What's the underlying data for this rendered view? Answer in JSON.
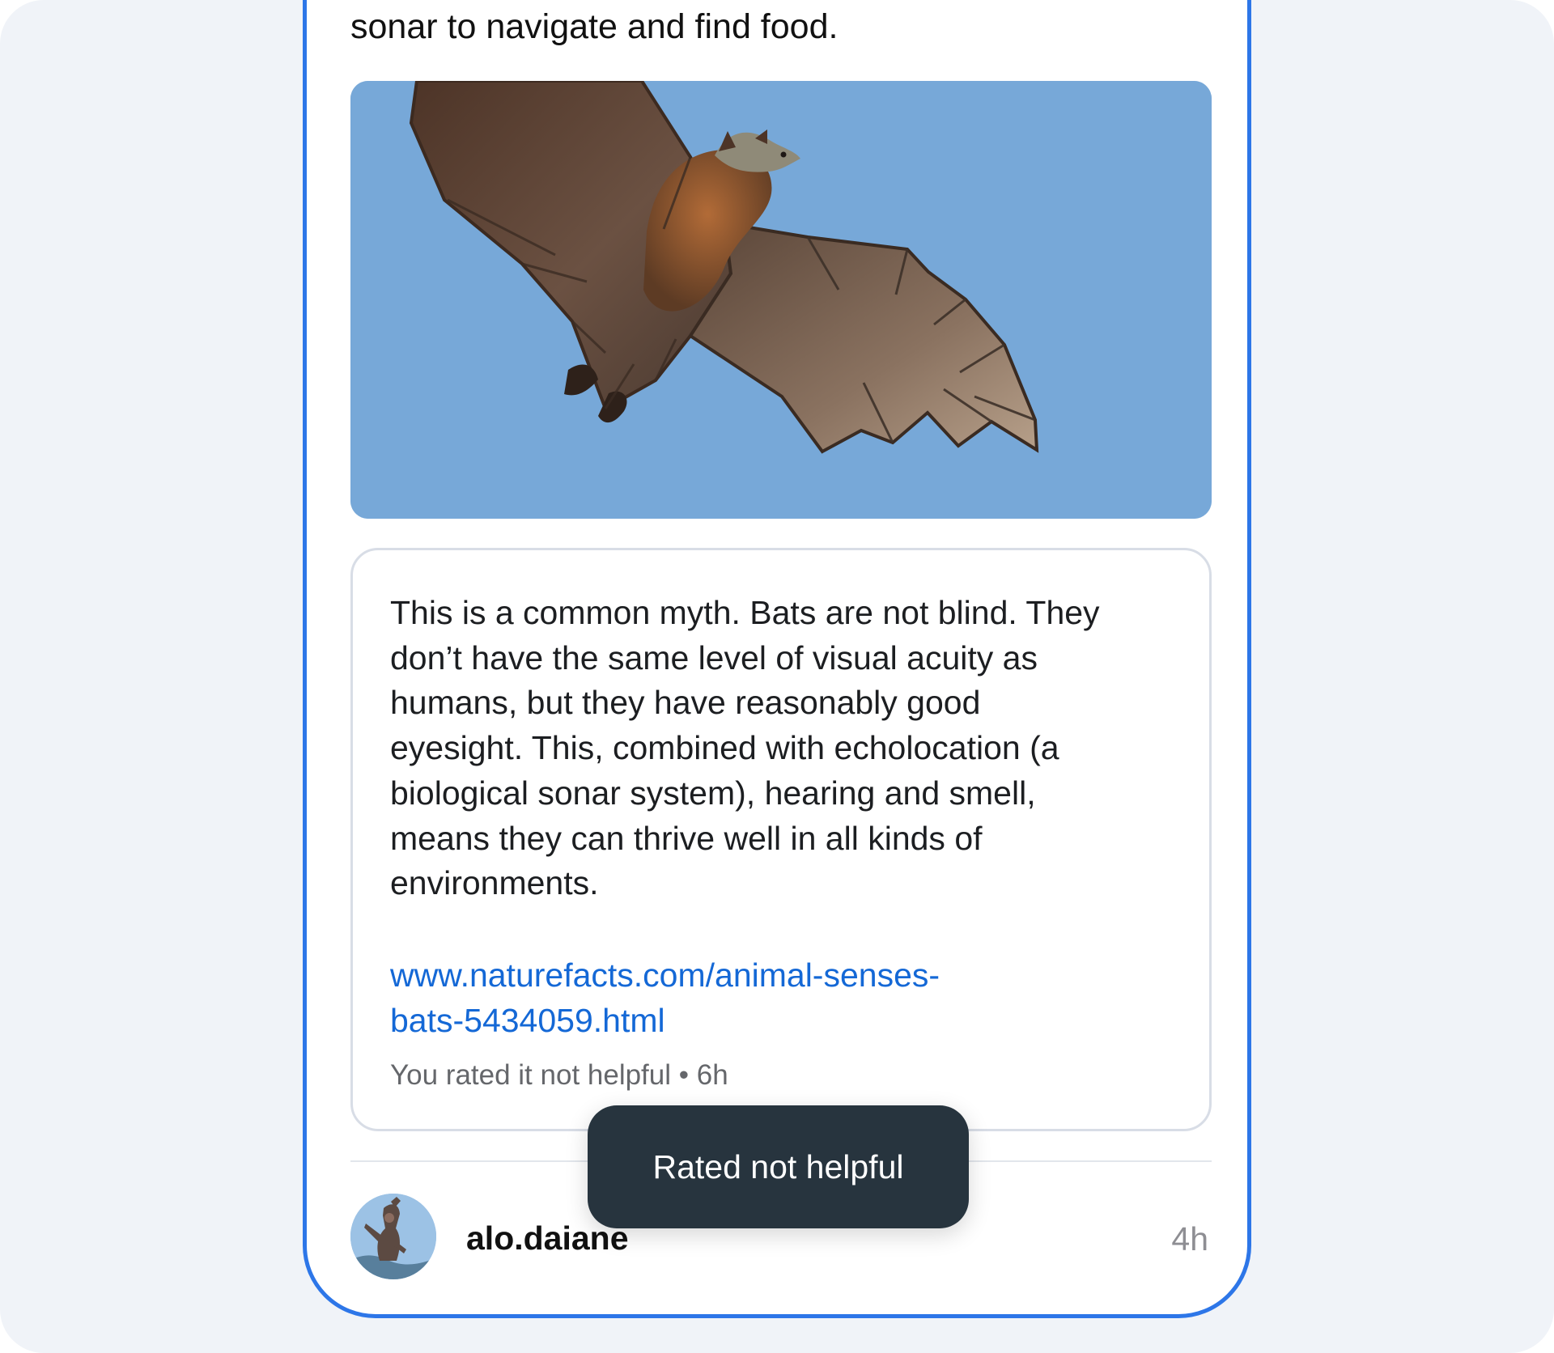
{
  "post": {
    "text": "sonar to navigate and find food."
  },
  "community_note": {
    "body": "This is a common myth. Bats are not blind. They\ndon’t have the same level of visual acuity as\nhumans, but they have reasonably good\neyesight. This, combined with echolocation (a\nbiological sonar system), hearing and smell,\nmeans they can thrive well in all kinds of\nenvironments.",
    "link_text": "www.naturefacts.com/animal-senses-\nbats-5434059.html",
    "meta": "You rated it not helpful • 6h"
  },
  "reply": {
    "username": "alo.daiane",
    "time": "4h"
  },
  "toast": {
    "message": "Rated not helpful"
  },
  "colors": {
    "background": "#f0f3f8",
    "frame_border": "#2d76e8",
    "link": "#1468d6",
    "toast_background": "#27343e",
    "sky": "#7aa9d9"
  }
}
